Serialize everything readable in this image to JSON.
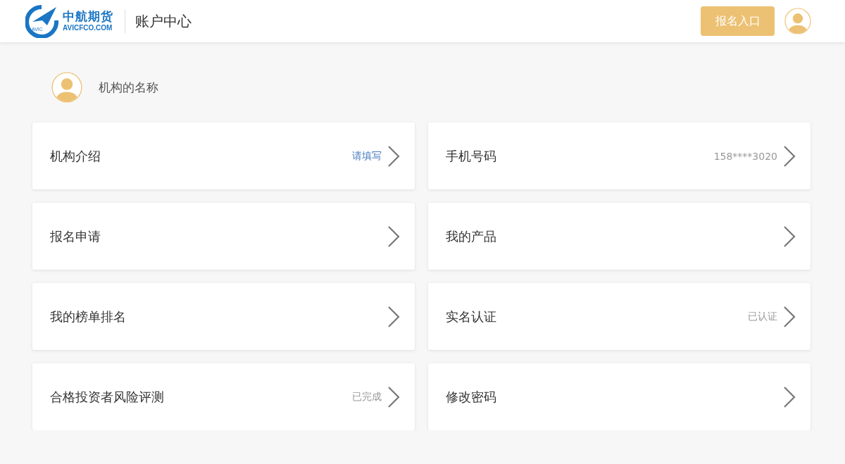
{
  "header": {
    "logo": {
      "mark_text": "AVIC",
      "name": "中航期货",
      "domain": "AVICFCO.COM"
    },
    "title": "账户中心",
    "signup_button": "报名入口"
  },
  "profile": {
    "name": "机构的名称"
  },
  "items": [
    {
      "label": "机构介绍",
      "status": "请填写",
      "kind": "prompt"
    },
    {
      "label": "手机号码",
      "status": "158****3020",
      "kind": "info"
    },
    {
      "label": "报名申请"
    },
    {
      "label": "我的产品"
    },
    {
      "label": "我的榜单排名"
    },
    {
      "label": "实名认证",
      "status": "已认证",
      "kind": "info"
    },
    {
      "label": "合格投资者风险评测",
      "status": "已完成",
      "kind": "info"
    },
    {
      "label": "修改密码"
    }
  ]
}
